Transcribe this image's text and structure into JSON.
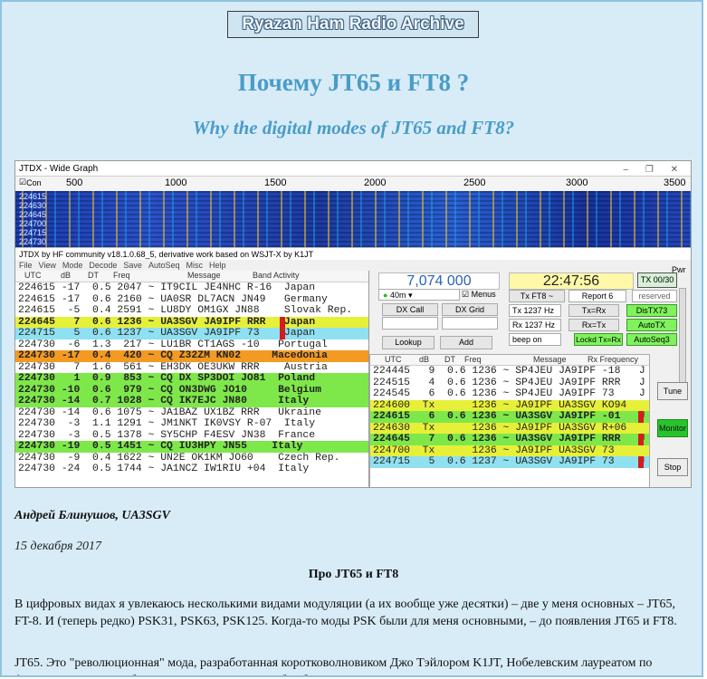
{
  "site": {
    "banner": "Ryazan Ham Radio Archive"
  },
  "article": {
    "title": "Почему JT65 и FT8 ?",
    "subtitle": "Why the digital modes of JT65 and FT8?",
    "author": "Андрей Блинушов, UA3SGV",
    "date": "15 декабря 2017",
    "section_heading": "Про JT65 и FT8",
    "paragraph1": "В цифровых видах я увлекаюсь несколькими видами модуляции (а их вообще уже десятки) – две у меня основных – JT65, FT-8. И (теперь редко) PSK31, PSK63, PSK125. Когда-то моды PSK были для меня основными, – до появления JT65 и FT8.",
    "paragraph2": "JT65. Это \"революционная\" мода, разработанная коротковолновиком Джо Тэйлором K1JT, Нобелевским лауреатом по физике. Позволяет работать с DX, не говоря уж об \"обычных\" станциях в условиях, когда прохождения, строго"
  },
  "wide_graph": {
    "title": "JTDX - Wide Graph",
    "window_buttons": "–  ❐  ✕",
    "con_label": "Con",
    "scale_labels": [
      "500",
      "1000",
      "1500",
      "2000",
      "2500",
      "3000",
      "3500"
    ],
    "waterfall_rows": [
      "224615",
      "224630",
      "224645",
      "224700",
      "224715",
      "224730"
    ]
  },
  "main_window": {
    "title": "JTDX   by HF community                                   v18.1.0.68_5, derivative work based on WSJT-X by K1JT",
    "menu": [
      "File",
      "View",
      "Mode",
      "Decode",
      "Save",
      "AutoSeq",
      "Misc",
      "Help"
    ],
    "band_header": {
      "utc": "UTC",
      "db": "dB",
      "dt": "DT",
      "freq": "Freq",
      "message": "Message",
      "title": "Band Activity"
    },
    "band_rows": [
      {
        "text": "224615 -17  0.5 2047 ~ IT9CIL JE4NHC R-16  Japan",
        "bg": "#ffffff"
      },
      {
        "text": "224615 -17  0.6 2160 ~ UA0SR DL7ACN JN49   Germany",
        "bg": "#ffffff"
      },
      {
        "text": "224615  -5  0.4 2591 ~ LU8DY OM1GX JN88    Slovak Rep.",
        "bg": "#ffffff"
      },
      {
        "text": "224645   7  0.6 1236 ~ UA3SGV JA9IPF RRR   Japan",
        "bg": "#e7f038",
        "mark": true,
        "bold": true
      },
      {
        "text": "224715   5  0.6 1237 ~ UA3SGV JA9IPF 73    Japan",
        "bg": "#8fe0f0",
        "mark": true
      },
      {
        "text": "224730  -6  1.3  217 ~ LU1BR CT1AGS -10   Portugal",
        "bg": "#ffffff"
      },
      {
        "text": "224730 -17  0.4  420 ~ CQ Z32ZM KN02     Macedonia",
        "bg": "#f39a22",
        "bold": true
      },
      {
        "text": "224730   7  1.6  561 ~ EH3DK OE3UKW RRR    Austria",
        "bg": "#ffffff"
      },
      {
        "text": "224730   1  0.9  853 ~ CQ DX SP3DOI JO81  Poland",
        "bg": "#7ee84a",
        "bold": true
      },
      {
        "text": "224730 -10  0.6  979 ~ CQ ON3DWG JO10     Belgium",
        "bg": "#7ee84a",
        "bold": true
      },
      {
        "text": "224730 -14  0.7 1028 ~ CQ IK7EJC JN80     Italy",
        "bg": "#7ee84a",
        "bold": true
      },
      {
        "text": "224730 -14  0.6 1075 ~ JA1BAZ UX1BZ RRR   Ukraine",
        "bg": "#ffffff"
      },
      {
        "text": "224730  -3  1.1 1291 ~ JM1NKT IK0VSY R-07  Italy",
        "bg": "#ffffff"
      },
      {
        "text": "224730  -3  0.5 1378 ~ SY5CHP F4ESV JN38  France",
        "bg": "#ffffff"
      },
      {
        "text": "224730 -19  0.5 1451 ~ CQ IU3HPY JN55    Italy",
        "bg": "#7ee84a",
        "bold": true
      },
      {
        "text": "224730  -9  0.4 1622 ~ UN2E OK1KM JO60    Czech Rep.",
        "bg": "#ffffff"
      },
      {
        "text": "224730 -24  0.5 1744 ~ JA1NCZ IW1RIU +04  Italy",
        "bg": "#ffffff"
      }
    ],
    "controls": {
      "frequency": "7,074 000",
      "clock": "22:47:56",
      "tx_status": "TX 00/30",
      "pwr": "Pwr",
      "band": "40m",
      "menus": "Menus",
      "tx_mode": "Tx FT8 ~",
      "report": "Report 6",
      "reserved": "reserved",
      "dx_call": "DX Call",
      "dx_grid": "DX Grid",
      "tx_hz": "Tx  1237  Hz",
      "rx_hz": "Rx  1237  Hz",
      "tx_rx": "Tx=Rx",
      "rx_tx": "Rx=Tx",
      "distx73": "DisTX73",
      "autotx": "AutoTX",
      "beep": "beep on",
      "lockd": "Lockd Tx=Rx",
      "autoseq3": "AutoSeq3",
      "lookup": "Lookup",
      "add": "Add"
    },
    "rx_header": {
      "utc": "UTC",
      "db": "dB",
      "dt": "DT",
      "freq": "Freq",
      "message": "Message",
      "title": "Rx Frequency"
    },
    "rx_rows": [
      {
        "text": "224445   9  0.6 1236 ~ SP4JEU JA9IPF -18   J",
        "bg": "#ffffff"
      },
      {
        "text": "224515   4  0.6 1236 ~ SP4JEU JA9IPF RRR   J",
        "bg": "#ffffff"
      },
      {
        "text": "224545   6  0.6 1236 ~ SP4JEU JA9IPF 73    J",
        "bg": "#ffffff"
      },
      {
        "text": "224600  Tx      1236 ~ JA9IPF UA3SGV KO94",
        "bg": "#e7f038"
      },
      {
        "text": "224615   6  0.6 1236 ~ UA3SGV JA9IPF -01   J",
        "bg": "#7ee84a",
        "mark": true,
        "bold": true
      },
      {
        "text": "224630  Tx      1236 ~ JA9IPF UA3SGV R+06",
        "bg": "#e7f038"
      },
      {
        "text": "224645   7  0.6 1236 ~ UA3SGV JA9IPF RRR   J",
        "bg": "#7ee84a",
        "mark": true,
        "bold": true
      },
      {
        "text": "224700  Tx      1236 ~ JA9IPF UA3SGV 73",
        "bg": "#e7f038"
      },
      {
        "text": "224715   5  0.6 1237 ~ UA3SGV JA9IPF 73    J",
        "bg": "#8fe0f0",
        "mark": true
      }
    ],
    "side_buttons": {
      "tune": "Tune",
      "monitor": "Monitor",
      "stop": "Stop"
    }
  }
}
